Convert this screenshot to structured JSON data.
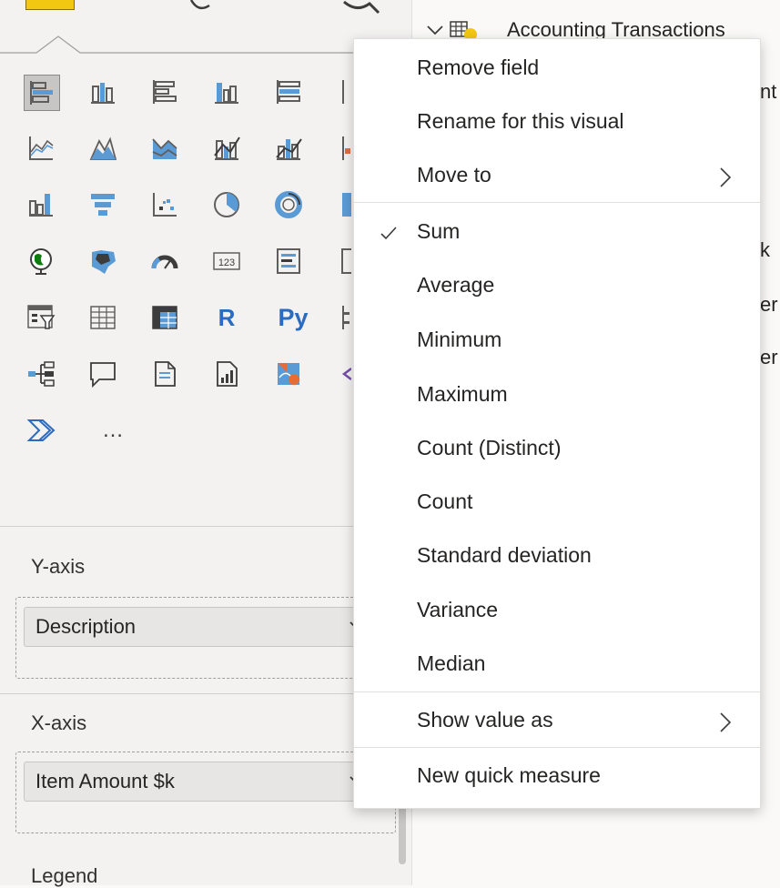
{
  "visualizations": {
    "icons": [
      "stacked-bar-chart-icon",
      "stacked-column-chart-icon",
      "clustered-bar-chart-icon",
      "clustered-column-chart-icon",
      "100-stacked-bar-chart-icon",
      "line-chart-icon",
      "area-chart-icon",
      "stacked-area-chart-icon",
      "line-and-column-chart-icon",
      "line-and-clustered-column-chart-icon",
      "ribbon-chart-icon",
      "funnel-chart-icon",
      "scatter-chart-icon",
      "pie-chart-icon",
      "donut-chart-icon",
      "map-icon",
      "filled-map-icon",
      "gauge-icon",
      "card-icon",
      "multi-row-card-icon",
      "slicer-icon",
      "table-icon",
      "matrix-icon",
      "r-visual-icon",
      "python-visual-icon",
      "decomposition-tree-icon",
      "qa-icon",
      "smart-narrative-icon",
      "paginated-report-icon",
      "arcgis-map-icon",
      "power-automate-icon",
      "more-visuals-icon"
    ],
    "r_label": "R",
    "py_label": "Py",
    "card_label": "123",
    "more_label": "…"
  },
  "wells": {
    "yaxis": {
      "label": "Y-axis",
      "field": "Description"
    },
    "xaxis": {
      "label": "X-axis",
      "field": "Item Amount $k"
    },
    "legend": {
      "label": "Legend"
    }
  },
  "fields_pane": {
    "table_name": "Accounting Transactions",
    "partial_items": [
      "nt",
      "k",
      "er",
      "er"
    ]
  },
  "context_menu": {
    "items": [
      {
        "label": "Remove field"
      },
      {
        "label": "Rename for this visual"
      },
      {
        "label": "Move to"
      },
      {
        "label": "Sum"
      },
      {
        "label": "Average"
      },
      {
        "label": "Minimum"
      },
      {
        "label": "Maximum"
      },
      {
        "label": "Count (Distinct)"
      },
      {
        "label": "Count"
      },
      {
        "label": "Standard deviation"
      },
      {
        "label": "Variance"
      },
      {
        "label": "Median"
      },
      {
        "label": "Show value as"
      },
      {
        "label": "New quick measure"
      }
    ],
    "selected_aggregation": "Sum"
  },
  "colors": {
    "accent_blue": "#118dff",
    "chart_blue": "#5b9bd5",
    "chart_dark": "#3c3c3c",
    "yellow": "#f2c811",
    "orange": "#e66c37",
    "purple": "#744da9"
  }
}
